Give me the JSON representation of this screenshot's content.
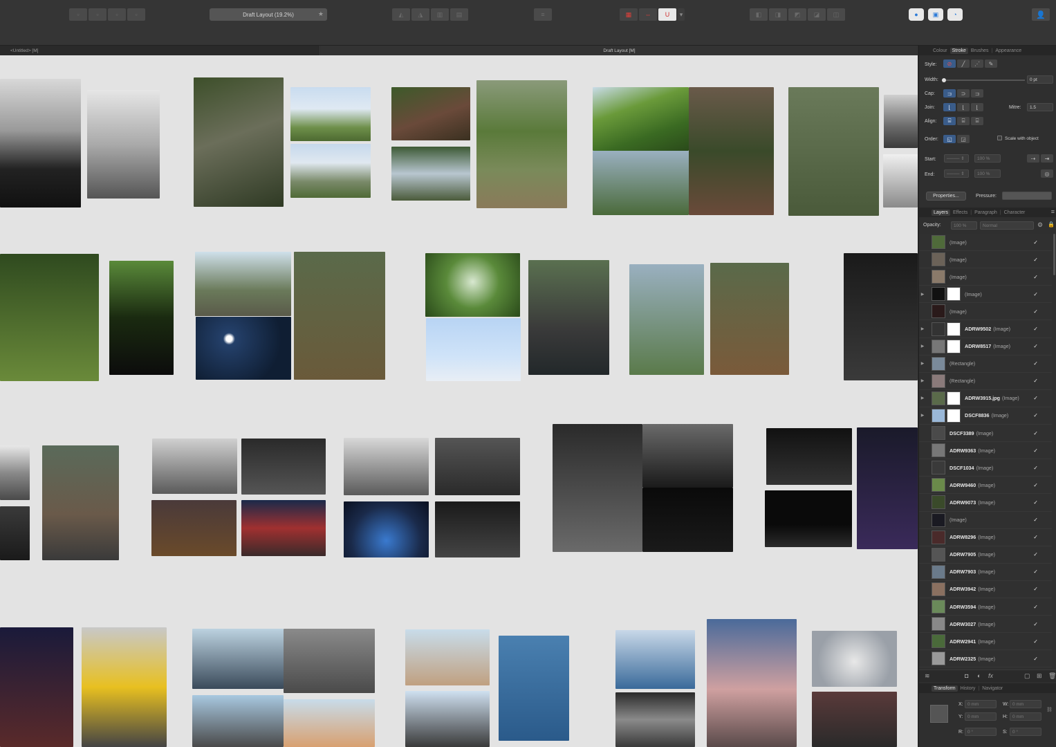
{
  "toolbar": {
    "zoom_label": "Draft Layout (19.2%)",
    "zoom_star": "★",
    "group1_icons": [
      "move-icon",
      "move-icon",
      "move-icon",
      "move-icon"
    ],
    "group3_icons": [
      "align-icon",
      "align-icon",
      "align-icon",
      "align-icon"
    ],
    "group4_icons": [
      "arrange-icon"
    ],
    "snap_group": {
      "grid": "▦",
      "snap": "⇔",
      "magnet": "U",
      "dropdown": "▾"
    },
    "group6_icons": [
      "boolean-icon",
      "boolean-icon",
      "boolean-icon",
      "boolean-icon",
      "boolean-icon"
    ],
    "group7_icons": [
      "persona-icon",
      "persona-icon",
      "persona-icon"
    ],
    "user_glyph": "👤"
  },
  "doctabs": {
    "untitled": "<Untitled> [M]",
    "draft": "Draft Layout [M]"
  },
  "stroke_panel": {
    "tabs": [
      "Colour",
      "Stroke",
      "Brushes",
      "Appearance"
    ],
    "active_tab": "Stroke",
    "style_label": "Style:",
    "width_label": "Width:",
    "width_value": "0 pt",
    "width_level": 0.0,
    "cap_label": "Cap:",
    "join_label": "Join:",
    "mitre_label": "Mitre:",
    "mitre_value": "1.5",
    "align_label": "Align:",
    "order_label": "Order:",
    "scale_label": "Scale with object",
    "start_label": "Start:",
    "end_label": "End:",
    "start_pct": "100 %",
    "end_pct": "100 %",
    "properties_label": "Properties...",
    "pressure_label": "Pressure:"
  },
  "layers_panel": {
    "tabs": [
      "Layers",
      "Effects",
      "Paragraph",
      "Character"
    ],
    "active_tab": "Layers",
    "opacity_label": "Opacity:",
    "opacity_value": "100 %",
    "blend_mode": "Normal",
    "check": "✓",
    "layers": [
      {
        "name": "",
        "type": "(Image)",
        "expand": false,
        "mask": false,
        "thumb": "#4f6a3a"
      },
      {
        "name": "",
        "type": "(Image)",
        "expand": false,
        "mask": false,
        "thumb": "#6b6258"
      },
      {
        "name": "",
        "type": "(Image)",
        "expand": false,
        "mask": false,
        "thumb": "#8a7a6a"
      },
      {
        "name": "",
        "type": "(Image)",
        "expand": true,
        "mask": true,
        "thumb": "#111111"
      },
      {
        "name": "",
        "type": "(Image)",
        "expand": false,
        "mask": false,
        "thumb": "#2a1a1a"
      },
      {
        "name": "ADRW9502",
        "type": "(Image)",
        "expand": true,
        "mask": true,
        "thumb": "#333333"
      },
      {
        "name": "ADRW8517",
        "type": "(Image)",
        "expand": true,
        "mask": true,
        "thumb": "#777777"
      },
      {
        "name": "",
        "type": "(Rectangle)",
        "expand": true,
        "mask": false,
        "thumb": "#7a8a9a"
      },
      {
        "name": "",
        "type": "(Rectangle)",
        "expand": true,
        "mask": false,
        "thumb": "#8a7a7a"
      },
      {
        "name": "ADRW3915.jpg",
        "type": "(Image)",
        "expand": true,
        "mask": true,
        "thumb": "#5a6a4a"
      },
      {
        "name": "DSCF8836",
        "type": "(Image)",
        "expand": true,
        "mask": true,
        "thumb": "#9ab8d8"
      },
      {
        "name": "DSCF3389",
        "type": "(Image)",
        "expand": false,
        "mask": false,
        "thumb": "#4a4a4a"
      },
      {
        "name": "ADRW9363",
        "type": "(Image)",
        "expand": false,
        "mask": false,
        "thumb": "#777777"
      },
      {
        "name": "DSCF1034",
        "type": "(Image)",
        "expand": false,
        "mask": false,
        "thumb": "#3a3a3a"
      },
      {
        "name": "ADRW9460",
        "type": "(Image)",
        "expand": false,
        "mask": false,
        "thumb": "#6a8a4a"
      },
      {
        "name": "ADRW9073",
        "type": "(Image)",
        "expand": false,
        "mask": false,
        "thumb": "#3a4a2a"
      },
      {
        "name": "",
        "type": "(Image)",
        "expand": false,
        "mask": false,
        "thumb": "#1a1a22"
      },
      {
        "name": "ADRW8296",
        "type": "(Image)",
        "expand": false,
        "mask": false,
        "thumb": "#4a2a2a"
      },
      {
        "name": "ADRW7905",
        "type": "(Image)",
        "expand": false,
        "mask": false,
        "thumb": "#555555"
      },
      {
        "name": "ADRW7903",
        "type": "(Image)",
        "expand": false,
        "mask": false,
        "thumb": "#6a7a8a"
      },
      {
        "name": "ADRW3942",
        "type": "(Image)",
        "expand": false,
        "mask": false,
        "thumb": "#8a7060"
      },
      {
        "name": "ADRW3594",
        "type": "(Image)",
        "expand": false,
        "mask": false,
        "thumb": "#6a8a5a"
      },
      {
        "name": "ADRW3027",
        "type": "(Image)",
        "expand": false,
        "mask": false,
        "thumb": "#888888"
      },
      {
        "name": "ADRW2941",
        "type": "(Image)",
        "expand": false,
        "mask": false,
        "thumb": "#4a6a3a"
      },
      {
        "name": "ADRW2325",
        "type": "(Image)",
        "expand": false,
        "mask": false,
        "thumb": "#9a9a9a"
      }
    ]
  },
  "transform_panel": {
    "tabs": [
      "Transform",
      "History",
      "Navigator"
    ],
    "active_tab": "Transform",
    "x_label": "X:",
    "x_value": "0 mm",
    "y_label": "Y:",
    "y_value": "0 mm",
    "w_label": "W:",
    "w_value": "0 mm",
    "h_label": "H:",
    "h_value": "0 mm",
    "r_label": "R:",
    "r_value": "0 °",
    "s_label": "S:",
    "s_value": "0 °"
  },
  "canvas": {
    "background": "#e3e3e3",
    "photos": [
      {
        "c": "linear-gradient(180deg,#d8d8d8 0%,#9a9a9a 40%,#222 70%,#111 100%)"
      },
      {
        "c": "linear-gradient(180deg,#e6e6e6 0%,#aaa 50%,#555 100%)"
      },
      {
        "c": "linear-gradient(160deg,#3d4f2a 0%,#6b6e5a 45%,#2f3a24 100%)"
      },
      {
        "c": "linear-gradient(180deg,#c9dcef 0%,#dfe9f3 40%,#6e8f4a 75%,#4d6a31 100%)"
      },
      {
        "c": "linear-gradient(180deg,#c5d8ec 0%,#e0e8f0 35%,#7a8a6a 70%,#4f6a36 100%)"
      },
      {
        "c": "linear-gradient(160deg,#3d5a2a 0%,#6a4a3a 55%,#3a3020 100%)"
      },
      {
        "c": "linear-gradient(180deg,#3d5a35 0%,#b8c6d0 50%,#4a5a3a 100%)"
      },
      {
        "c": "linear-gradient(180deg,#8a9a7a 0%,#5a7a3a 40%,#7a8a5a 70%,#8a7a5a 100%)"
      },
      {
        "c": "linear-gradient(160deg,#c9dce8 0%,#6a9a3a 35%,#3a6a22 70%,#2a4a1a 100%)"
      },
      {
        "c": "linear-gradient(180deg,#6a5a4a 0%,#3a4a2a 50%,#6a4a3a 100%)"
      },
      {
        "c": "linear-gradient(180deg,#9ab0c0 0%,#4a6a3a 100%)"
      },
      {
        "c": "linear-gradient(180deg,#6a7a5a 0%,#4a5a3a 100%)"
      },
      {
        "c": "linear-gradient(180deg,#cfcfcf 0%,#6a6a6a 60%,#3a3a3a 100%)"
      },
      {
        "c": "linear-gradient(180deg,#f0f0f0 0%,#8a8a8a 100%)"
      },
      {
        "c": "linear-gradient(180deg,#2f4a1f 0%,#6a8a3a 100%)"
      },
      {
        "c": "linear-gradient(180deg,#5a8a3a 0%,#1a2a10 50%,#0c0c0c 100%)"
      },
      {
        "c": "linear-gradient(180deg,#cfe0ea 0%,#6a7a5a 60%,#5a5a4a 100%)"
      },
      {
        "c": "linear-gradient(180deg,#5a6a4a 0%,#6a5a3a 100%)"
      },
      {
        "c": "radial-gradient(circle at 35% 35%,#ffffff 0 4%,#24406a 8%,#0f1e33 70%)"
      },
      {
        "c": "radial-gradient(circle at 50% 45%,#d8e8d0 0%,#5a8a3a 45%,#2a4a1a 100%)"
      },
      {
        "c": "linear-gradient(180deg,#b8d4f4 0%,#cfe3f8 60%,#e8eef5 100%)"
      },
      {
        "c": "linear-gradient(180deg,#5a7050 0%,#3a3a3a 60%,#22282a 100%)"
      },
      {
        "c": "linear-gradient(180deg,#9ab0c0 0%,#5a7a4a 100%)"
      },
      {
        "c": "linear-gradient(180deg,#5a6a4a 0%,#7a5a3a 100%)"
      },
      {
        "c": "linear-gradient(180deg,#1a1a1a 0%,#3a3a3a 100%)"
      },
      {
        "c": "linear-gradient(180deg,#e8e8e8 0%,#8a8a8a 50%,#4a4a4a 100%)"
      },
      {
        "c": "linear-gradient(180deg,#3a3a3a 0%,#1a1a1a 100%)"
      },
      {
        "c": "linear-gradient(180deg,#5a6a5a 0%,#6a5a4a 60%,#3a3a3a 100%)"
      },
      {
        "c": "linear-gradient(180deg,#d0d0d0 0%,#5a5a5a 100%)"
      },
      {
        "c": "linear-gradient(180deg,#2a2a2a 0%,#555 100%)"
      },
      {
        "c": "linear-gradient(180deg,#4a3a3a 0%,#6a4a2a 100%)"
      },
      {
        "c": "linear-gradient(180deg,#1a2a4a 0%,#a03030 50%,#3a2a2a 100%)"
      },
      {
        "c": "linear-gradient(180deg,#d8d8d8 0%,#5a5a5a 100%)"
      },
      {
        "c": "linear-gradient(180deg,#555 0%,#2a2a2a 100%)"
      },
      {
        "c": "radial-gradient(circle at 50% 70%,#3a7acf 0%,#1a2a4a 60%,#0a1020 100%)"
      },
      {
        "c": "linear-gradient(180deg,#1a1a1a 0%,#444 100%)"
      },
      {
        "c": "linear-gradient(180deg,#2a2a2a 0%,#6a6a6a 100%)"
      },
      {
        "c": "linear-gradient(180deg,#6a6a6a 0%,#1a1a1a 100%)"
      },
      {
        "c": "linear-gradient(180deg,#0a0a0a 0%,#1a1a1a 100%)"
      },
      {
        "c": "linear-gradient(180deg,#111 0%,#333 100%)"
      },
      {
        "c": "linear-gradient(180deg,#0a0a0a 0%,#0a0a0a 60%,#2a2a2a 100%)"
      },
      {
        "c": "linear-gradient(180deg,#1a1a2a 0%,#3a2a5a 100%)"
      },
      {
        "c": "linear-gradient(180deg,#1a1a3a 0%,#5a2a2a 100%)"
      },
      {
        "c": "linear-gradient(180deg,#c8c8c8 0%,#e8c020 50%,#444 100%)"
      },
      {
        "c": "linear-gradient(180deg,#bcd2e0 0%,#3a4a5a 100%)"
      },
      {
        "c": "linear-gradient(180deg,#8a8a8a 0%,#4a4a4a 100%)"
      },
      {
        "c": "linear-gradient(180deg,#a8c8e0 0%,#4a4a4a 100%)"
      },
      {
        "c": "linear-gradient(180deg,#c8dcea 0%,#d8a070 100%)"
      },
      {
        "c": "linear-gradient(180deg,#c8dcea 0%,#c0a080 100%)"
      },
      {
        "c": "linear-gradient(180deg,#cfe0f0 0%,#3a3a3a 100%)"
      },
      {
        "c": "linear-gradient(180deg,#4a80b0 0%,#2a5a8a 100%)"
      },
      {
        "c": "linear-gradient(180deg,#c8d8e8 0%,#3a6a9a 100%)"
      },
      {
        "c": "linear-gradient(180deg,#2a2a2a 0%,#8a8a8a 50%,#3a3a3a 100%)"
      },
      {
        "c": "linear-gradient(180deg,#4a6a9a 0%,#cfa0a0 55%,#5a4a4a 100%)"
      },
      {
        "c": "radial-gradient(circle at 50% 55%,#e8e8e8 0%,#9aa0a8 70%)"
      },
      {
        "c": "linear-gradient(180deg,#5a3a3a 0%,#2a2a2a 100%)"
      }
    ]
  }
}
